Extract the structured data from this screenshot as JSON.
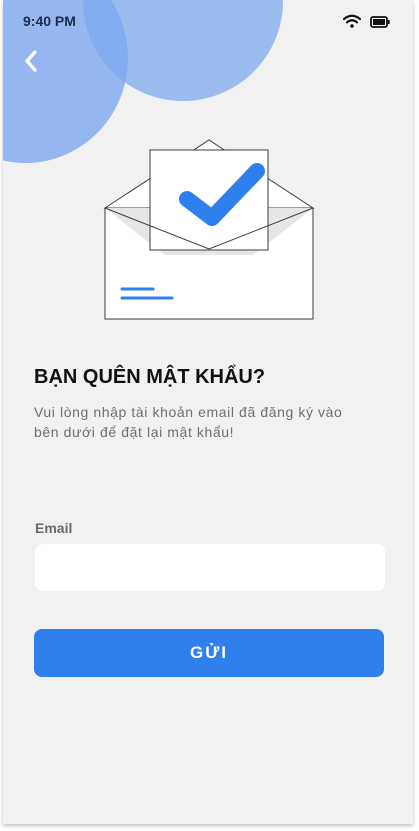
{
  "status_bar": {
    "time": "9:40 PM",
    "icons": [
      "wifi-icon",
      "battery-icon"
    ]
  },
  "header": {
    "back_icon": "chevron-left-icon"
  },
  "illustration": {
    "icon": "open-envelope-checkmark-icon"
  },
  "content": {
    "title": "BẠN QUÊN MẬT KHẨU?",
    "subtitle": "Vui lòng nhập tài khoản email đã đăng ký vào bên dưới để đặt lại mật khẩu!"
  },
  "form": {
    "email_label": "Email",
    "email_value": "",
    "email_placeholder": "",
    "submit_label": "GỬI"
  },
  "colors": {
    "background": "#f1f1f1",
    "bubble": "#7aa7ee",
    "accent": "#2f80ed",
    "status_time": "#1d2b4c",
    "title": "#111111",
    "subtitle": "#6f6f6f"
  }
}
